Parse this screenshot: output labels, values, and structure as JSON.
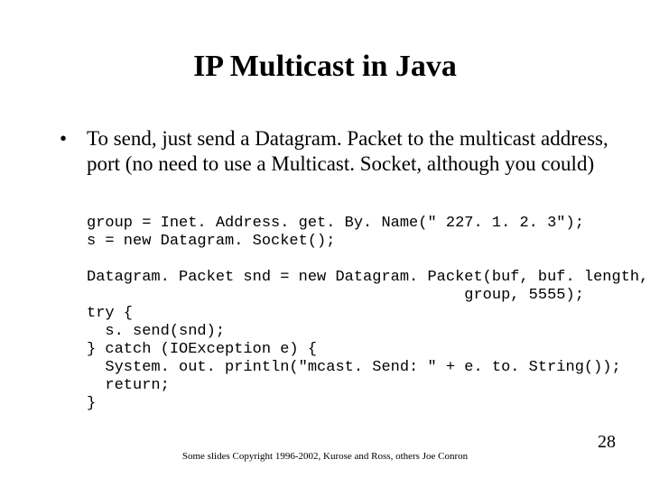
{
  "title": "IP Multicast in Java",
  "bullet": {
    "marker": "•",
    "text": "To send, just send a Datagram. Packet to the multicast address, port (no need to use a Multicast. Socket, although you could)"
  },
  "code": "group = Inet. Address. get. By. Name(\" 227. 1. 2. 3\");\ns = new Datagram. Socket();\n\nDatagram. Packet snd = new Datagram. Packet(buf, buf. length,\n                                         group, 5555);\ntry {\n  s. send(snd);\n} catch (IOException e) {\n  System. out. println(\"mcast. Send: \" + e. to. String());\n  return;\n}",
  "footer": "Some slides Copyright 1996-2002, Kurose and Ross, others Joe Conron",
  "page_number": "28"
}
